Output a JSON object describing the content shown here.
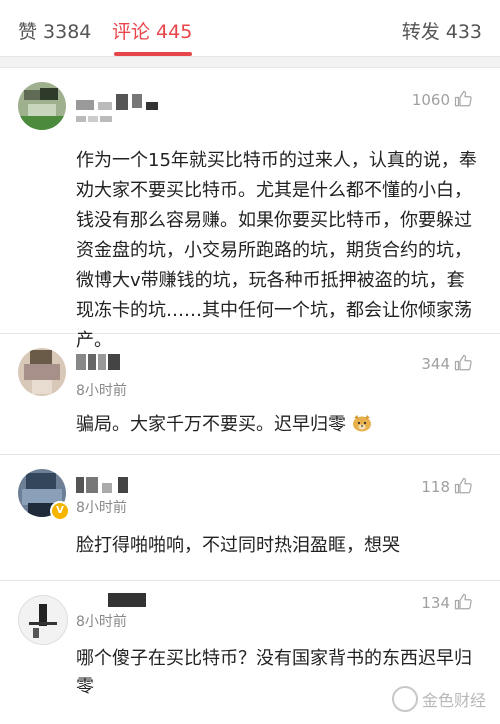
{
  "tabs": {
    "likes": "赞 3384",
    "comments": "评论 445",
    "reposts": "转发 433"
  },
  "comments": [
    {
      "time": "",
      "likes": "1060",
      "text": "作为一个15年就买比特币的过来人，认真的说，奉劝大家不要买比特币。尤其是什么都不懂的小白，钱没有那么容易赚。如果你要买比特币，你要躲过资金盘的坑，小交易所跑路的坑，期货合约的坑，微博大v带赚钱的坑，玩各种币抵押被盗的坑，套现冻卡的坑……其中任何一个坑，都会让你倾家荡产。"
    },
    {
      "time": "8小时前",
      "likes": "344",
      "text": "骗局。大家千万不要买。迟早归零"
    },
    {
      "time": "8小时前",
      "likes": "118",
      "text": "脸打得啪啪响，不过同时热泪盈眶，想哭"
    },
    {
      "time": "8小时前",
      "likes": "134",
      "text": "哪个傻子在买比特币？没有国家背书的东西迟早归零"
    }
  ],
  "icons": {
    "like": "thumbs-up-icon",
    "emoji": "doge-emoji-icon",
    "verified": "verified-v-badge-icon"
  },
  "colors": {
    "accent": "#e8454a",
    "muted": "#8a8a8a",
    "badge": "#f4b400"
  },
  "watermark": "金色财经"
}
